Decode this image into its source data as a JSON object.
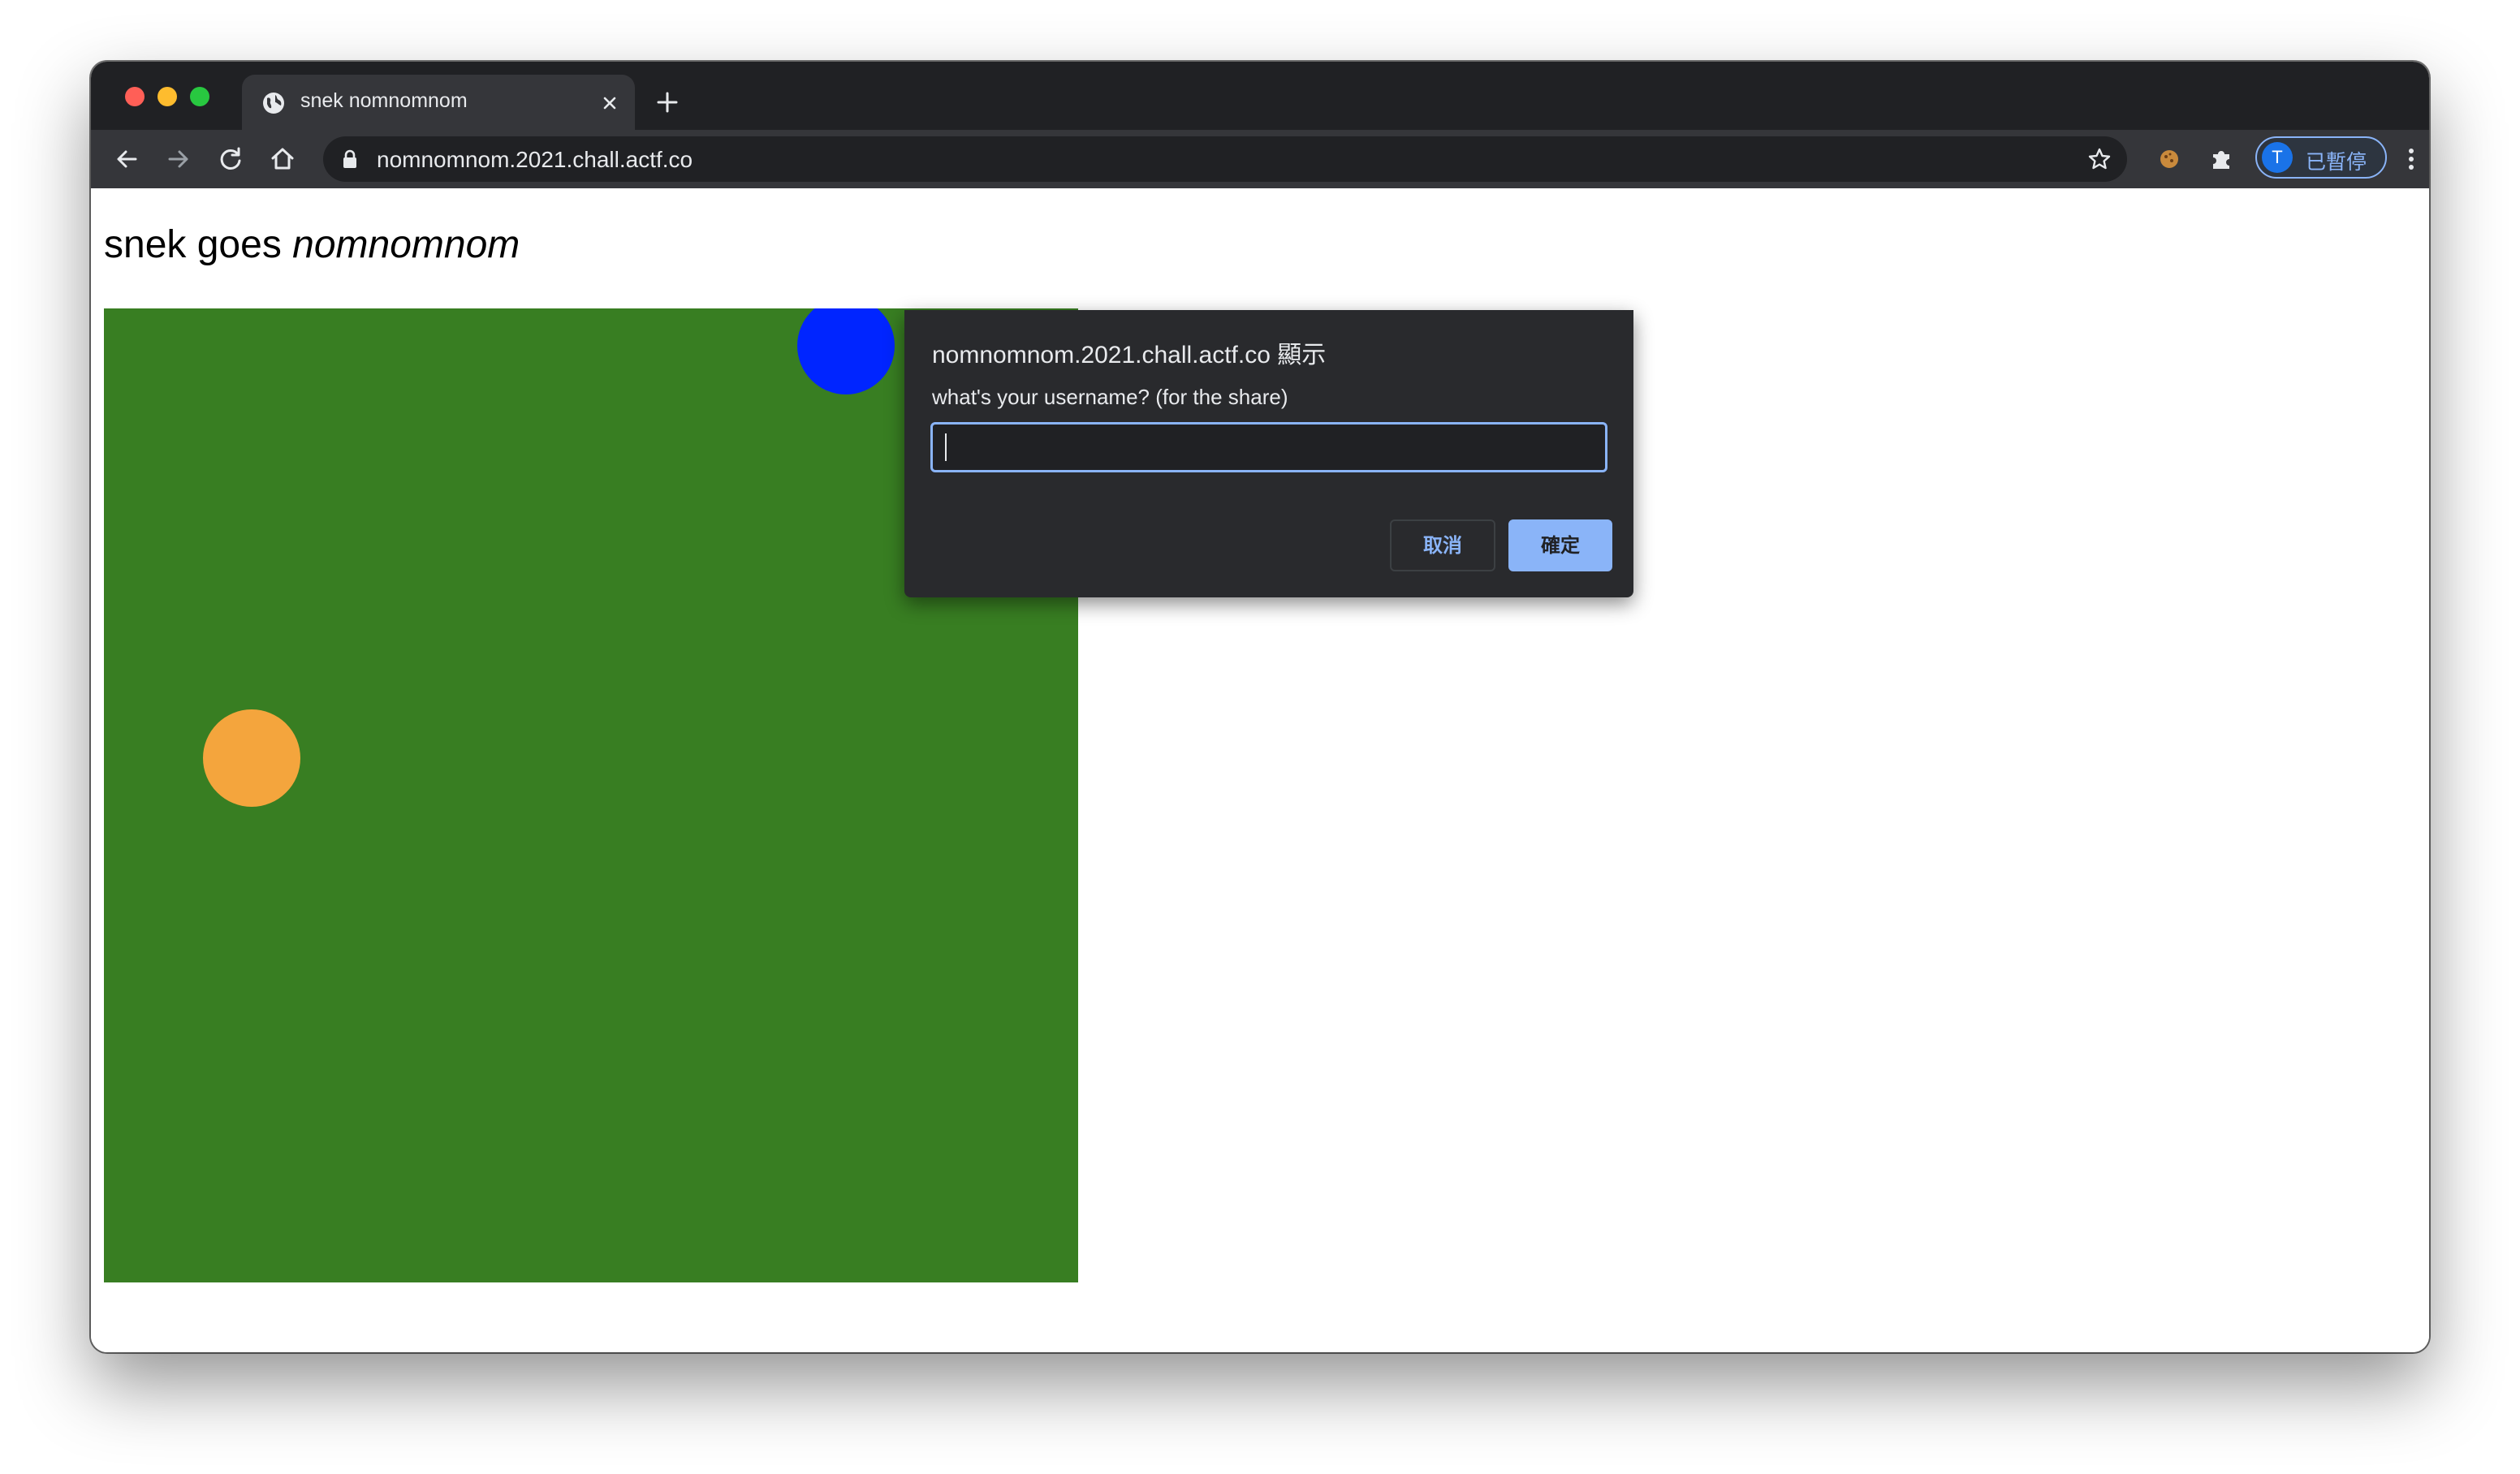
{
  "browser": {
    "tab": {
      "title": "snek nomnomnom",
      "favicon_icon": "globe-icon",
      "close_icon": "close-icon"
    },
    "new_tab_icon": "plus-icon",
    "toolbar": {
      "back_icon": "arrow-left-icon",
      "forward_icon": "arrow-right-icon",
      "reload_icon": "reload-icon",
      "home_icon": "home-icon",
      "lock_icon": "lock-icon",
      "url": "nomnomnom.2021.chall.actf.co",
      "bookmark_icon": "star-icon",
      "extension_icon": "cookie-icon",
      "extensions_menu_icon": "puzzle-icon",
      "profile": {
        "initial": "T",
        "status": "已暫停"
      },
      "menu_icon": "kebab-menu-icon"
    }
  },
  "page": {
    "heading_plain": "snek goes ",
    "heading_italic": "nomnomnom",
    "board": {
      "background_color": "#387e22",
      "snake_color": "#0025ff",
      "food_color": "#f4a53d",
      "snake_icon": "blue-circle",
      "food_icon": "orange-circle"
    }
  },
  "dialog": {
    "origin": "nomnomnom.2021.chall.actf.co 顯示",
    "message": "what's your username? (for the share)",
    "input_value": "",
    "cancel_label": "取消",
    "ok_label": "確定"
  }
}
